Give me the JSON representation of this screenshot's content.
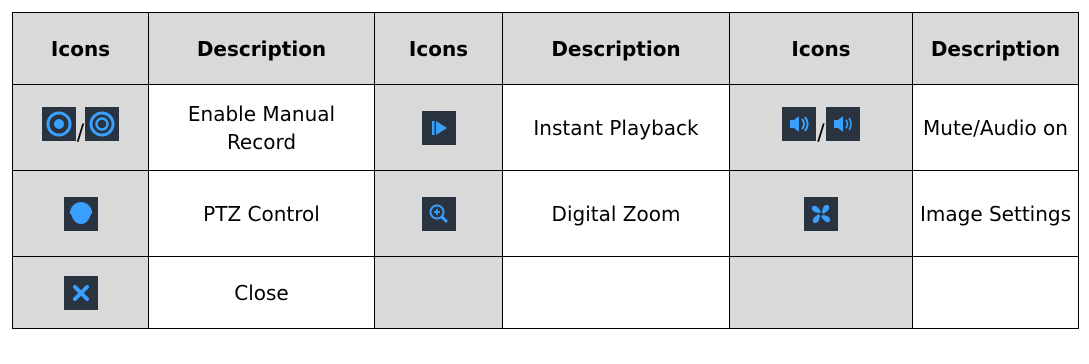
{
  "table": {
    "headers": [
      "Icons",
      "Description",
      "Icons",
      "Description",
      "Icons",
      "Description"
    ],
    "rows": [
      {
        "cells": [
          {
            "icons": [
              "record-on-icon",
              "record-off-icon"
            ],
            "separator": "/"
          },
          {
            "text": "Enable Manual Record"
          },
          {
            "icons": [
              "instant-playback-icon"
            ]
          },
          {
            "text": "Instant Playback"
          },
          {
            "icons": [
              "mute-icon",
              "audio-on-icon"
            ],
            "separator": "/"
          },
          {
            "text": "Mute/Audio on"
          }
        ]
      },
      {
        "cells": [
          {
            "icons": [
              "ptz-dome-icon"
            ]
          },
          {
            "text": "PTZ Control"
          },
          {
            "icons": [
              "digital-zoom-icon"
            ]
          },
          {
            "text": "Digital Zoom"
          },
          {
            "icons": [
              "image-settings-icon"
            ]
          },
          {
            "text": "Image Settings"
          }
        ]
      },
      {
        "cells": [
          {
            "icons": [
              "close-icon"
            ]
          },
          {
            "text": "Close"
          },
          {
            "icons": []
          },
          {
            "text": ""
          },
          {
            "icons": []
          },
          {
            "text": ""
          }
        ]
      }
    ]
  },
  "colors": {
    "header_bg": "#d9d9d9",
    "icon_cell_bg": "#d9d9d9",
    "icon_bg": "#2a3440",
    "icon_accent": "#3aa0ff",
    "border": "#000000"
  }
}
